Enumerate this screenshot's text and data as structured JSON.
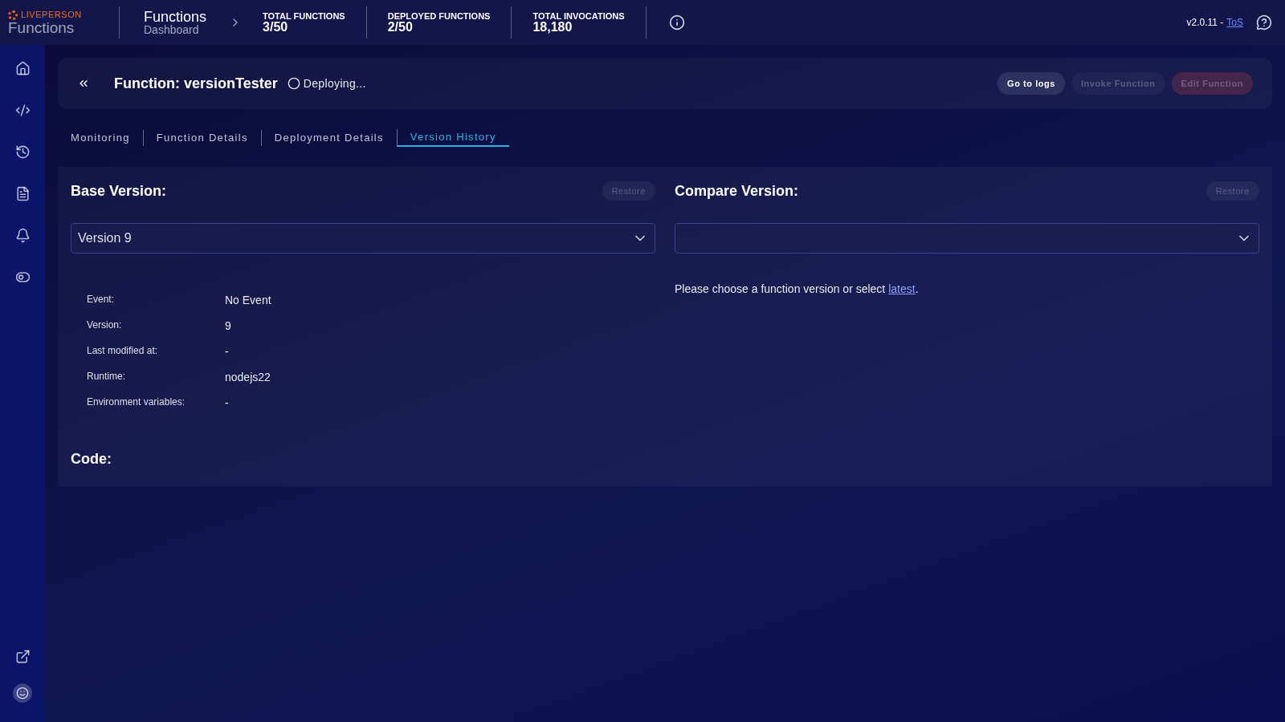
{
  "header": {
    "brand": "LIVEPERSON",
    "product": "Functions",
    "title": "Functions",
    "subtitle": "Dashboard",
    "stats": [
      {
        "label": "TOTAL FUNCTIONS",
        "value": "3/50"
      },
      {
        "label": "DEPLOYED FUNCTIONS",
        "value": "2/50"
      },
      {
        "label": "TOTAL INVOCATIONS",
        "value": "18,180"
      }
    ],
    "version": "v2.0.11 -",
    "tos": "ToS"
  },
  "function": {
    "title": "Function: versionTester",
    "status": "Deploying...",
    "actions": [
      {
        "label": "Go to logs",
        "disabled": false,
        "kind": "default"
      },
      {
        "label": "Invoke Function",
        "disabled": true,
        "kind": "default"
      },
      {
        "label": "Edit Function",
        "disabled": true,
        "kind": "danger"
      }
    ]
  },
  "tabs": [
    {
      "label": "Monitoring",
      "selected": false
    },
    {
      "label": "Function Details",
      "selected": false
    },
    {
      "label": "Deployment Details",
      "selected": false
    },
    {
      "label": "Version History",
      "selected": true
    }
  ],
  "base": {
    "heading": "Base Version:",
    "restore": {
      "label": "Restore",
      "disabled": true
    },
    "select_value": "Version 9",
    "details": [
      {
        "label": "Event:",
        "value": "No Event"
      },
      {
        "label": "Version:",
        "value": "9"
      },
      {
        "label": "Last modified at:",
        "value": "-"
      },
      {
        "label": "Runtime:",
        "value": "nodejs22"
      },
      {
        "label": "Environment variables:",
        "value": "-"
      }
    ]
  },
  "compare": {
    "heading": "Compare Version:",
    "restore": {
      "label": "Restore",
      "disabled": true
    },
    "message": "Please choose a function version or select",
    "link": "latest",
    "message_end": "."
  },
  "code": {
    "heading": "Code:"
  }
}
